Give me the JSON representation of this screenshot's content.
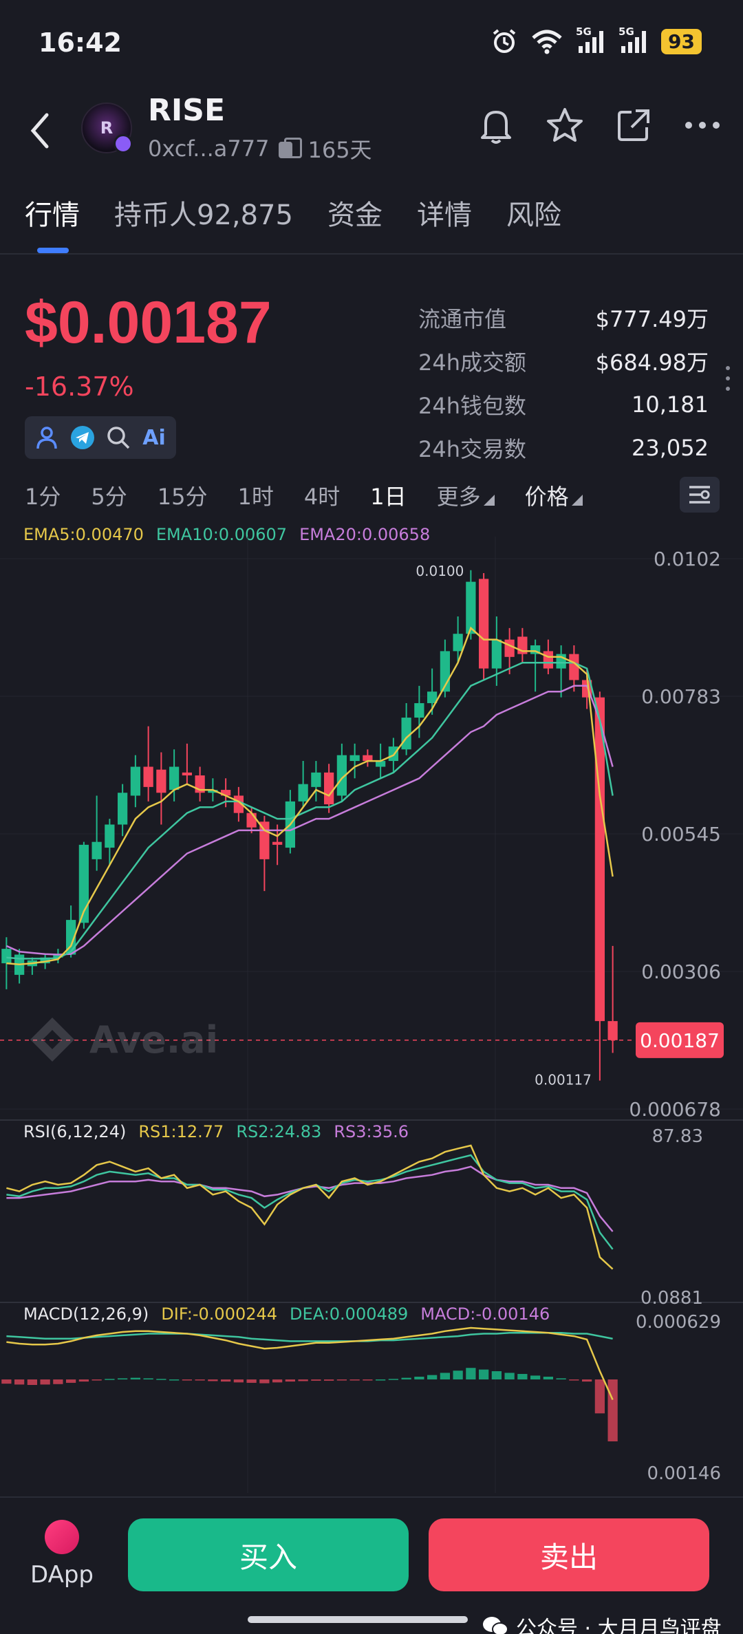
{
  "status_bar": {
    "time": "16:42",
    "battery": "93",
    "net1": "5G",
    "net2": "5G"
  },
  "header": {
    "token_name": "RISE",
    "logo_text": "R",
    "address": "0xcf...a777",
    "age": "165天"
  },
  "tabs": [
    {
      "label": "行情",
      "active": true
    },
    {
      "label": "持币人92,875",
      "active": false
    },
    {
      "label": "资金",
      "active": false
    },
    {
      "label": "详情",
      "active": false
    },
    {
      "label": "风险",
      "active": false
    }
  ],
  "price": {
    "value": "$0.00187",
    "change": "-16.37%"
  },
  "social": {
    "ai_label": "Ai"
  },
  "stats": [
    {
      "label": "流通市值",
      "value": "$777.49万"
    },
    {
      "label": "24h成交额",
      "value": "$684.98万"
    },
    {
      "label": "24h钱包数",
      "value": "10,181"
    },
    {
      "label": "24h交易数",
      "value": "23,052"
    }
  ],
  "intervals": [
    {
      "label": "1分",
      "active": false
    },
    {
      "label": "5分",
      "active": false
    },
    {
      "label": "15分",
      "active": false
    },
    {
      "label": "1时",
      "active": false
    },
    {
      "label": "4时",
      "active": false
    },
    {
      "label": "1日",
      "active": true
    },
    {
      "label": "更多",
      "active": false,
      "caret": true
    },
    {
      "label": "价格",
      "active": false,
      "caret": true
    }
  ],
  "ema": [
    {
      "label": "EMA5:0.00470",
      "color": "#e6c84a"
    },
    {
      "label": "EMA10:0.00607",
      "color": "#3fc6a0"
    },
    {
      "label": "EMA20:0.00658",
      "color": "#c77ddb"
    }
  ],
  "colors": {
    "up": "#1fb98a",
    "down": "#f4455d",
    "ema5": "#e6c84a",
    "ema10": "#3fc6a0",
    "ema20": "#c77ddb"
  },
  "chart_data": {
    "type": "candlestick",
    "price_axis_ticks": [
      "0.0102",
      "0.00783",
      "0.00545",
      "0.00306",
      "0.000678"
    ],
    "current_price_label": "0.00187",
    "high_label": "0.0100",
    "low_label": "0.00117",
    "watermark": "Ave.ai",
    "candles": [
      {
        "o": 0.0032,
        "h": 0.00365,
        "l": 0.00275,
        "c": 0.00345
      },
      {
        "o": 0.003,
        "h": 0.00345,
        "l": 0.00285,
        "c": 0.00335
      },
      {
        "o": 0.00315,
        "h": 0.0033,
        "l": 0.003,
        "c": 0.00325
      },
      {
        "o": 0.0032,
        "h": 0.00335,
        "l": 0.0031,
        "c": 0.0033
      },
      {
        "o": 0.0033,
        "h": 0.00345,
        "l": 0.0032,
        "c": 0.00335
      },
      {
        "o": 0.00335,
        "h": 0.0042,
        "l": 0.0033,
        "c": 0.00395
      },
      {
        "o": 0.0039,
        "h": 0.0053,
        "l": 0.0038,
        "c": 0.00525
      },
      {
        "o": 0.005,
        "h": 0.0061,
        "l": 0.0048,
        "c": 0.0053
      },
      {
        "o": 0.0052,
        "h": 0.0057,
        "l": 0.0049,
        "c": 0.0056
      },
      {
        "o": 0.0056,
        "h": 0.0063,
        "l": 0.0054,
        "c": 0.00615
      },
      {
        "o": 0.0061,
        "h": 0.0068,
        "l": 0.0059,
        "c": 0.0066
      },
      {
        "o": 0.0066,
        "h": 0.0073,
        "l": 0.006,
        "c": 0.00625
      },
      {
        "o": 0.00655,
        "h": 0.00685,
        "l": 0.0056,
        "c": 0.00615
      },
      {
        "o": 0.0062,
        "h": 0.0069,
        "l": 0.006,
        "c": 0.0066
      },
      {
        "o": 0.0065,
        "h": 0.007,
        "l": 0.0063,
        "c": 0.00645
      },
      {
        "o": 0.00645,
        "h": 0.0066,
        "l": 0.006,
        "c": 0.00615
      },
      {
        "o": 0.00615,
        "h": 0.0064,
        "l": 0.006,
        "c": 0.0062
      },
      {
        "o": 0.0062,
        "h": 0.0064,
        "l": 0.0059,
        "c": 0.0061
      },
      {
        "o": 0.0061,
        "h": 0.00625,
        "l": 0.00565,
        "c": 0.0058
      },
      {
        "o": 0.0058,
        "h": 0.0059,
        "l": 0.00545,
        "c": 0.00555
      },
      {
        "o": 0.00565,
        "h": 0.00575,
        "l": 0.00445,
        "c": 0.005
      },
      {
        "o": 0.0053,
        "h": 0.0056,
        "l": 0.0049,
        "c": 0.00525
      },
      {
        "o": 0.0052,
        "h": 0.0062,
        "l": 0.0051,
        "c": 0.006
      },
      {
        "o": 0.006,
        "h": 0.0067,
        "l": 0.0059,
        "c": 0.0063
      },
      {
        "o": 0.00625,
        "h": 0.0067,
        "l": 0.006,
        "c": 0.0065
      },
      {
        "o": 0.0065,
        "h": 0.00665,
        "l": 0.0058,
        "c": 0.00595
      },
      {
        "o": 0.0061,
        "h": 0.007,
        "l": 0.006,
        "c": 0.0068
      },
      {
        "o": 0.0067,
        "h": 0.007,
        "l": 0.0064,
        "c": 0.0068
      },
      {
        "o": 0.0068,
        "h": 0.0069,
        "l": 0.0066,
        "c": 0.0067
      },
      {
        "o": 0.0066,
        "h": 0.007,
        "l": 0.0064,
        "c": 0.0067
      },
      {
        "o": 0.0067,
        "h": 0.0071,
        "l": 0.0065,
        "c": 0.00695
      },
      {
        "o": 0.0069,
        "h": 0.0077,
        "l": 0.0068,
        "c": 0.00745
      },
      {
        "o": 0.00745,
        "h": 0.008,
        "l": 0.0071,
        "c": 0.0077
      },
      {
        "o": 0.0077,
        "h": 0.0083,
        "l": 0.0075,
        "c": 0.0079
      },
      {
        "o": 0.0079,
        "h": 0.0088,
        "l": 0.0078,
        "c": 0.0086
      },
      {
        "o": 0.0086,
        "h": 0.0092,
        "l": 0.0084,
        "c": 0.0089
      },
      {
        "o": 0.0089,
        "h": 0.01,
        "l": 0.0088,
        "c": 0.0098
      },
      {
        "o": 0.00985,
        "h": 0.00995,
        "l": 0.0081,
        "c": 0.0083
      },
      {
        "o": 0.0083,
        "h": 0.0092,
        "l": 0.008,
        "c": 0.0088
      },
      {
        "o": 0.0088,
        "h": 0.009,
        "l": 0.0082,
        "c": 0.0085
      },
      {
        "o": 0.00885,
        "h": 0.009,
        "l": 0.0084,
        "c": 0.00855
      },
      {
        "o": 0.00855,
        "h": 0.0088,
        "l": 0.0079,
        "c": 0.0087
      },
      {
        "o": 0.0086,
        "h": 0.0088,
        "l": 0.0082,
        "c": 0.0083
      },
      {
        "o": 0.0083,
        "h": 0.0087,
        "l": 0.0078,
        "c": 0.00855
      },
      {
        "o": 0.00855,
        "h": 0.0087,
        "l": 0.0079,
        "c": 0.0081
      },
      {
        "o": 0.0081,
        "h": 0.0083,
        "l": 0.0076,
        "c": 0.0078
      },
      {
        "o": 0.0078,
        "h": 0.0079,
        "l": 0.00117,
        "c": 0.0022
      },
      {
        "o": 0.0022,
        "h": 0.0035,
        "l": 0.00165,
        "c": 0.00187
      }
    ],
    "ema5": [
      0.0032,
      0.00318,
      0.0032,
      0.00323,
      0.00327,
      0.0035,
      0.0041,
      0.0045,
      0.0049,
      0.0053,
      0.0057,
      0.0059,
      0.006,
      0.0062,
      0.0063,
      0.0062,
      0.0062,
      0.0061,
      0.006,
      0.0058,
      0.0055,
      0.0054,
      0.0056,
      0.0059,
      0.0062,
      0.0061,
      0.0064,
      0.0066,
      0.0067,
      0.0067,
      0.0068,
      0.0071,
      0.0073,
      0.0076,
      0.008,
      0.0084,
      0.009,
      0.0088,
      0.0088,
      0.0087,
      0.0086,
      0.0086,
      0.0085,
      0.0085,
      0.0084,
      0.0082,
      0.0061,
      0.0047
    ],
    "ema10": [
      0.0033,
      0.00328,
      0.00328,
      0.00328,
      0.00329,
      0.0034,
      0.0037,
      0.004,
      0.0043,
      0.0046,
      0.0049,
      0.0052,
      0.0054,
      0.0056,
      0.0058,
      0.0059,
      0.0059,
      0.006,
      0.006,
      0.0059,
      0.0058,
      0.0057,
      0.0057,
      0.0058,
      0.0059,
      0.0059,
      0.006,
      0.0062,
      0.0063,
      0.0064,
      0.0065,
      0.0067,
      0.0069,
      0.0071,
      0.0074,
      0.0077,
      0.008,
      0.0081,
      0.0082,
      0.0083,
      0.0084,
      0.0084,
      0.0084,
      0.0084,
      0.0084,
      0.0083,
      0.0074,
      0.0061
    ],
    "ema20": [
      0.0035,
      0.0034,
      0.00338,
      0.00336,
      0.00335,
      0.00336,
      0.0035,
      0.0037,
      0.0039,
      0.0041,
      0.0043,
      0.0045,
      0.0047,
      0.0049,
      0.0051,
      0.0052,
      0.0053,
      0.0054,
      0.0055,
      0.0055,
      0.0055,
      0.0055,
      0.0055,
      0.0056,
      0.0057,
      0.0057,
      0.0058,
      0.0059,
      0.006,
      0.0061,
      0.0062,
      0.0063,
      0.0064,
      0.0066,
      0.0068,
      0.007,
      0.0072,
      0.0073,
      0.0075,
      0.0076,
      0.0077,
      0.0078,
      0.0079,
      0.0079,
      0.008,
      0.008,
      0.0074,
      0.0066
    ],
    "rsi": {
      "legend": "RSI(6,12,24)",
      "labels": [
        {
          "text": "RS1:12.77",
          "color": "#e6c84a"
        },
        {
          "text": "RS2:24.83",
          "color": "#3fc6a0"
        },
        {
          "text": "RS3:35.6",
          "color": "#c77ddb"
        }
      ],
      "ticks": [
        "87.83",
        "0.0881"
      ],
      "rs1": [
        62,
        60,
        64,
        66,
        64,
        65,
        70,
        76,
        78,
        75,
        72,
        74,
        68,
        70,
        62,
        64,
        58,
        60,
        54,
        50,
        40,
        52,
        58,
        62,
        64,
        56,
        66,
        68,
        64,
        66,
        70,
        74,
        78,
        80,
        84,
        86,
        88,
        70,
        62,
        60,
        62,
        58,
        62,
        56,
        58,
        50,
        20,
        12.77
      ],
      "rs2": [
        58,
        57,
        60,
        62,
        62,
        63,
        66,
        70,
        72,
        71,
        70,
        71,
        68,
        68,
        64,
        64,
        61,
        61,
        58,
        56,
        50,
        55,
        59,
        62,
        64,
        60,
        65,
        67,
        66,
        67,
        69,
        72,
        74,
        76,
        78,
        80,
        82,
        72,
        67,
        65,
        65,
        62,
        63,
        60,
        60,
        55,
        35,
        24.83
      ],
      "rs3": [
        56,
        56,
        57,
        58,
        59,
        60,
        62,
        64,
        66,
        66,
        66,
        67,
        66,
        66,
        64,
        64,
        62,
        62,
        61,
        60,
        57,
        58,
        60,
        62,
        63,
        62,
        64,
        65,
        65,
        65,
        66,
        68,
        69,
        70,
        72,
        73,
        75,
        70,
        67,
        66,
        66,
        64,
        64,
        62,
        62,
        59,
        45,
        35.6
      ]
    },
    "macd": {
      "legend": "MACD(12,26,9)",
      "labels": [
        {
          "text": "DIF:-0.000244",
          "color": "#e6c84a"
        },
        {
          "text": "DEA:0.000489",
          "color": "#3fc6a0"
        },
        {
          "text": "MACD:-0.00146",
          "color": "#c77ddb"
        }
      ],
      "ticks": [
        "0.000629",
        "0.00146"
      ],
      "hist": [
        -0.0001,
        -0.00012,
        -0.00013,
        -0.00012,
        -0.00011,
        -8e-05,
        -5e-05,
        -2e-05,
        1e-05,
        2e-05,
        3e-05,
        2e-05,
        1e-05,
        0.0,
        -1e-05,
        -2e-05,
        -4e-05,
        -5e-05,
        -7e-05,
        -8e-05,
        -9e-05,
        -7e-05,
        -5e-05,
        -4e-05,
        -3e-05,
        -3e-05,
        -2e-05,
        -2e-05,
        -1e-05,
        0.0,
        1e-05,
        3e-05,
        5e-05,
        8e-05,
        0.00012,
        0.00016,
        0.00021,
        0.00018,
        0.00015,
        0.00012,
        0.0001,
        7e-05,
        5e-05,
        2e-05,
        -1e-05,
        -5e-05,
        -0.0008,
        -0.00146
      ],
      "dif": [
        0.00045,
        0.00043,
        0.00042,
        0.00042,
        0.00043,
        0.00046,
        0.0005,
        0.00053,
        0.00055,
        0.00057,
        0.00058,
        0.00058,
        0.00057,
        0.00056,
        0.00055,
        0.00053,
        0.0005,
        0.00047,
        0.00043,
        0.0004,
        0.00037,
        0.00038,
        0.0004,
        0.00042,
        0.00044,
        0.00044,
        0.00045,
        0.00046,
        0.00047,
        0.00048,
        0.00049,
        0.00051,
        0.00053,
        0.00055,
        0.00058,
        0.0006,
        0.00062,
        0.00061,
        0.0006,
        0.00059,
        0.00058,
        0.00057,
        0.00056,
        0.00054,
        0.00052,
        0.00048,
        0.0001,
        -0.000244
      ],
      "dea": [
        0.00052,
        0.00051,
        0.0005,
        0.00049,
        0.00049,
        0.00049,
        0.0005,
        0.00051,
        0.00052,
        0.00053,
        0.00054,
        0.00055,
        0.00055,
        0.00055,
        0.00055,
        0.00054,
        0.00053,
        0.00052,
        0.00051,
        0.00049,
        0.00048,
        0.00047,
        0.00046,
        0.00046,
        0.00046,
        0.00046,
        0.00046,
        0.00046,
        0.00046,
        0.00047,
        0.00047,
        0.00048,
        0.00049,
        0.0005,
        0.00051,
        0.00052,
        0.00054,
        0.00055,
        0.00055,
        0.00056,
        0.00056,
        0.00056,
        0.00056,
        0.00056,
        0.00055,
        0.00055,
        0.00052,
        0.000489
      ]
    }
  },
  "bottom": {
    "dapp": "DApp",
    "buy": "买入",
    "sell": "卖出",
    "watermark_text": "公众号 · 大月月鸟评盘"
  }
}
